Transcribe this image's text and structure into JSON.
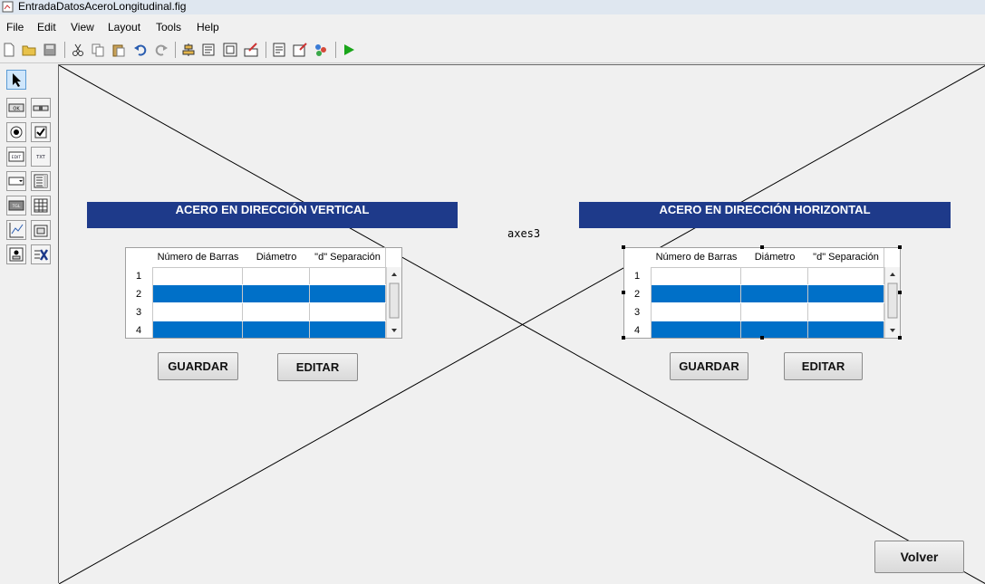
{
  "window": {
    "title": "EntradaDatosAceroLongitudinal.fig"
  },
  "menu": [
    "File",
    "Edit",
    "View",
    "Layout",
    "Tools",
    "Help"
  ],
  "toolbar": {
    "icons": [
      "new-file-icon",
      "open-folder-icon",
      "save-icon",
      "cut-icon",
      "copy-icon",
      "paste-icon",
      "undo-icon",
      "redo-icon",
      "align-objects-icon",
      "menu-editor-icon",
      "tab-order-icon",
      "toolbar-editor-icon",
      "mfile-editor-icon",
      "property-inspector-icon",
      "object-browser-icon",
      "run-figure-icon"
    ]
  },
  "palette": {
    "tools": [
      "select-icon",
      "push-button-icon",
      "slider-icon",
      "radio-button-icon",
      "checkbox-icon",
      "edit-text-icon",
      "static-text-icon",
      "popup-menu-icon",
      "listbox-icon",
      "toggle-button-icon",
      "table-icon",
      "axes-icon",
      "panel-icon",
      "button-group-icon",
      "activex-icon"
    ]
  },
  "axes_label": "axes3",
  "left_panel": {
    "title": "ACERO EN DIRECCIÓN VERTICAL",
    "columns": [
      "Número de Barras",
      "Diámetro",
      "\"d\" Separación"
    ],
    "rows": [
      "1",
      "2",
      "3",
      "4"
    ],
    "save_label": "GUARDAR",
    "edit_label": "EDITAR"
  },
  "right_panel": {
    "title": "ACERO EN DIRECCIÓN HORIZONTAL",
    "columns": [
      "Número de Barras",
      "Diámetro",
      "\"d\" Separación"
    ],
    "rows": [
      "1",
      "2",
      "3",
      "4"
    ],
    "save_label": "GUARDAR",
    "edit_label": "EDITAR"
  },
  "back_label": "Volver",
  "colors": {
    "panel_title_bg": "#1e3a8a",
    "selected_row": "#0070c8"
  }
}
